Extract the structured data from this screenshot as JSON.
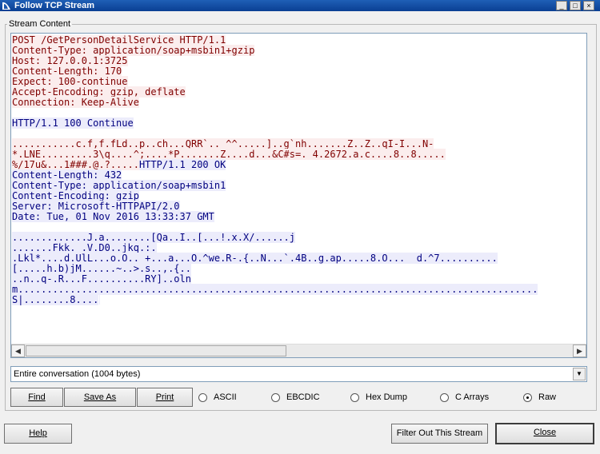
{
  "window": {
    "title": "Follow TCP Stream",
    "controls": {
      "minimize": "_",
      "maximize": "□",
      "close": "×"
    }
  },
  "group": {
    "legend": "Stream Content"
  },
  "stream": {
    "lines": [
      {
        "dir": "client",
        "text": "POST /GetPersonDetailService HTTP/1.1"
      },
      {
        "dir": "client",
        "text": "Content-Type: application/soap+msbin1+gzip"
      },
      {
        "dir": "client",
        "text": "Host: 127.0.0.1:3725"
      },
      {
        "dir": "client",
        "text": "Content-Length: 170"
      },
      {
        "dir": "client",
        "text": "Expect: 100-continue"
      },
      {
        "dir": "client",
        "text": "Accept-Encoding: gzip, deflate"
      },
      {
        "dir": "client",
        "text": "Connection: Keep-Alive"
      },
      {
        "dir": "blank",
        "text": ""
      },
      {
        "dir": "server",
        "text": "HTTP/1.1 100 Continue"
      },
      {
        "dir": "blank",
        "text": ""
      },
      {
        "dir": "client",
        "text": "...........c.f,f.fLd..p..ch...QRR`.._^^.....]..g`nh.......Z..Z..qI-I...N-"
      },
      {
        "dir": "client",
        "text": "*.LNE.........3\\q....^;....*P.......Z....d...&C#s=. 4.2672.a.c....8..8....."
      },
      {
        "dir": "mixed",
        "text": "%/17u&...1###.@.?.....",
        "text2": "HTTP/1.1 200 OK"
      },
      {
        "dir": "server",
        "text": "Content-Length: 432"
      },
      {
        "dir": "server",
        "text": "Content-Type: application/soap+msbin1"
      },
      {
        "dir": "server",
        "text": "Content-Encoding: gzip"
      },
      {
        "dir": "server",
        "text": "Server: Microsoft-HTTPAPI/2.0"
      },
      {
        "dir": "server",
        "text": "Date: Tue, 01 Nov 2016 13:33:37 GMT"
      },
      {
        "dir": "blank",
        "text": ""
      },
      {
        "dir": "server",
        "text": ".............J.a........[Qa..I..[...!.x.X/......j"
      },
      {
        "dir": "server",
        "text": ".......Fkk._.V.D0..jkq.:."
      },
      {
        "dir": "server",
        "text": ".Lkl*....d.UlL...o.O.._+...a...O.^we.R-.{..N...`.4B..g.ap.....8.O...  d.^7.........."
      },
      {
        "dir": "server",
        "text": "[.....h.b)jM......~..>.s..,.{.."
      },
      {
        "dir": "server",
        "text": "..n..q-.R...F..........RY]..oln"
      },
      {
        "dir": "server",
        "text": "m.........................................................................................."
      },
      {
        "dir": "server",
        "text": "S|........8....",
        "caret": true
      }
    ]
  },
  "conversation_select": {
    "value": "Entire conversation (1004 bytes)"
  },
  "buttons": {
    "find": "Find",
    "save_as": "Save As",
    "print": "Print",
    "help": "Help",
    "filter_out": "Filter Out This Stream",
    "close": "Close"
  },
  "formats": [
    {
      "label": "ASCII",
      "selected": false
    },
    {
      "label": "EBCDIC",
      "selected": false
    },
    {
      "label": "Hex Dump",
      "selected": false
    },
    {
      "label": "C Arrays",
      "selected": false
    },
    {
      "label": "Raw",
      "selected": true
    }
  ],
  "colors": {
    "client_text": "#800000",
    "client_bg": "#fbeded",
    "server_text": "#000080",
    "server_bg": "#ececfb",
    "titlebar": "#0a3f93"
  }
}
